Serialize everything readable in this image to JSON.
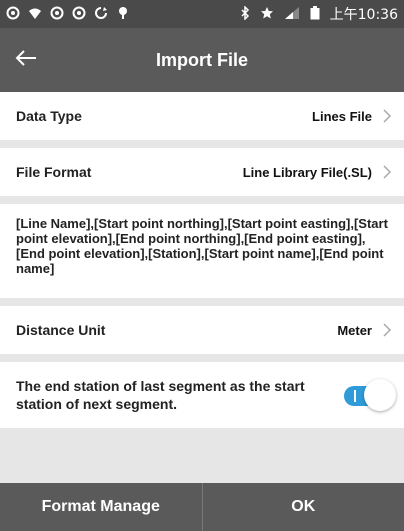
{
  "status_bar": {
    "time": "上午10:36",
    "icons": [
      "notification-icon",
      "wifi-icon",
      "notification-icon",
      "notification-icon",
      "sync-icon",
      "location-icon",
      "bluetooth-icon",
      "star-icon",
      "signal-icon",
      "battery-icon"
    ]
  },
  "header": {
    "title": "Import File"
  },
  "settings": {
    "data_type": {
      "label": "Data Type",
      "value": "Lines File"
    },
    "file_format": {
      "label": "File Format",
      "value": "Line Library File(.SL)"
    },
    "format_description": "[Line Name],[Start point northing],[Start point easting],[Start point elevation],[End point northing],[End point easting],[End point elevation],[Station],[Start point name],[End point name]",
    "distance_unit": {
      "label": "Distance Unit",
      "value": "Meter"
    },
    "end_station_toggle": {
      "label": "The end station of last segment as the start station of next segment.",
      "state": "on"
    }
  },
  "footer": {
    "format_manage": "Format Manage",
    "ok": "OK"
  },
  "colors": {
    "accent": "#2f9bd8",
    "bar": "#5a5a5a",
    "background": "#e6e6e6"
  }
}
